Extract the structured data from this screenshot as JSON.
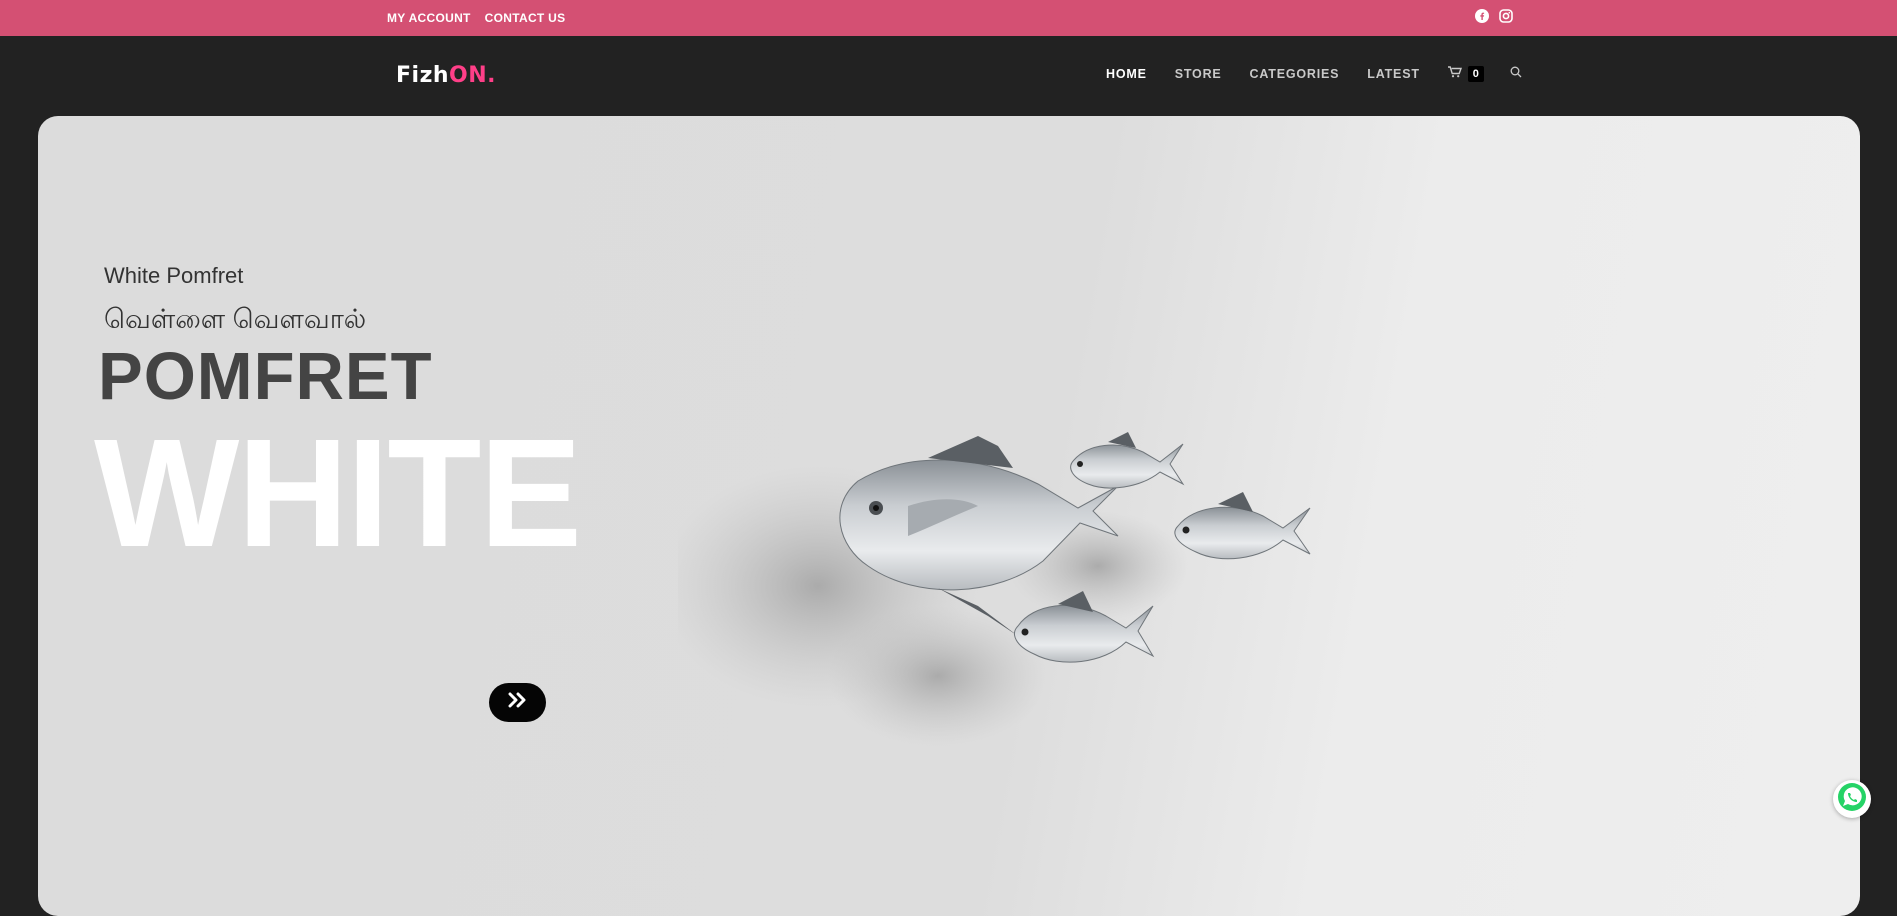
{
  "topbar": {
    "links": [
      "MY ACCOUNT",
      "CONTACT US"
    ],
    "social_icons": [
      "facebook-icon",
      "instagram-icon"
    ],
    "background": "#d45073"
  },
  "header": {
    "logo": {
      "part1": "Fizh",
      "part2": "ON",
      "part3": "."
    },
    "nav": [
      "HOME",
      "STORE",
      "CATEGORIES",
      "LATEST"
    ],
    "active_nav": "HOME",
    "cart_count": "0",
    "icons": [
      "cart-icon",
      "search-icon"
    ]
  },
  "hero": {
    "subtitle": "White Pomfret",
    "subtitle_tamil": "வெள்ளை வெளவால்",
    "title_main": "POMFRET",
    "title_big": "WHITE",
    "next_icon": "double-chevron-right-icon",
    "image": "white-pomfret-fish-image"
  },
  "floating": {
    "whatsapp_icon": "whatsapp-icon",
    "whatsapp_color": "#25d366"
  }
}
